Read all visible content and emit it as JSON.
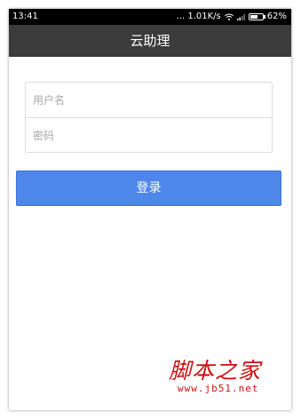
{
  "status_bar": {
    "time": "13:41",
    "network_speed": "... 1.01K/s",
    "battery_level": "62%",
    "battery_fraction": 0.62,
    "icons": [
      "wifi-icon",
      "signal-icon",
      "battery-icon"
    ]
  },
  "header": {
    "title": "云助理"
  },
  "login_form": {
    "username_placeholder": "用户名",
    "password_placeholder": "密码",
    "login_label": "登录"
  },
  "watermark": {
    "logo_text": "脚本之家",
    "url": "www.jb51.net"
  },
  "colors": {
    "status_bar": "#000000",
    "title_bar": "#3b3b3b",
    "login_button": "#4f86e9",
    "watermark": "#cc1010",
    "field_border": "#dcdcdc"
  }
}
